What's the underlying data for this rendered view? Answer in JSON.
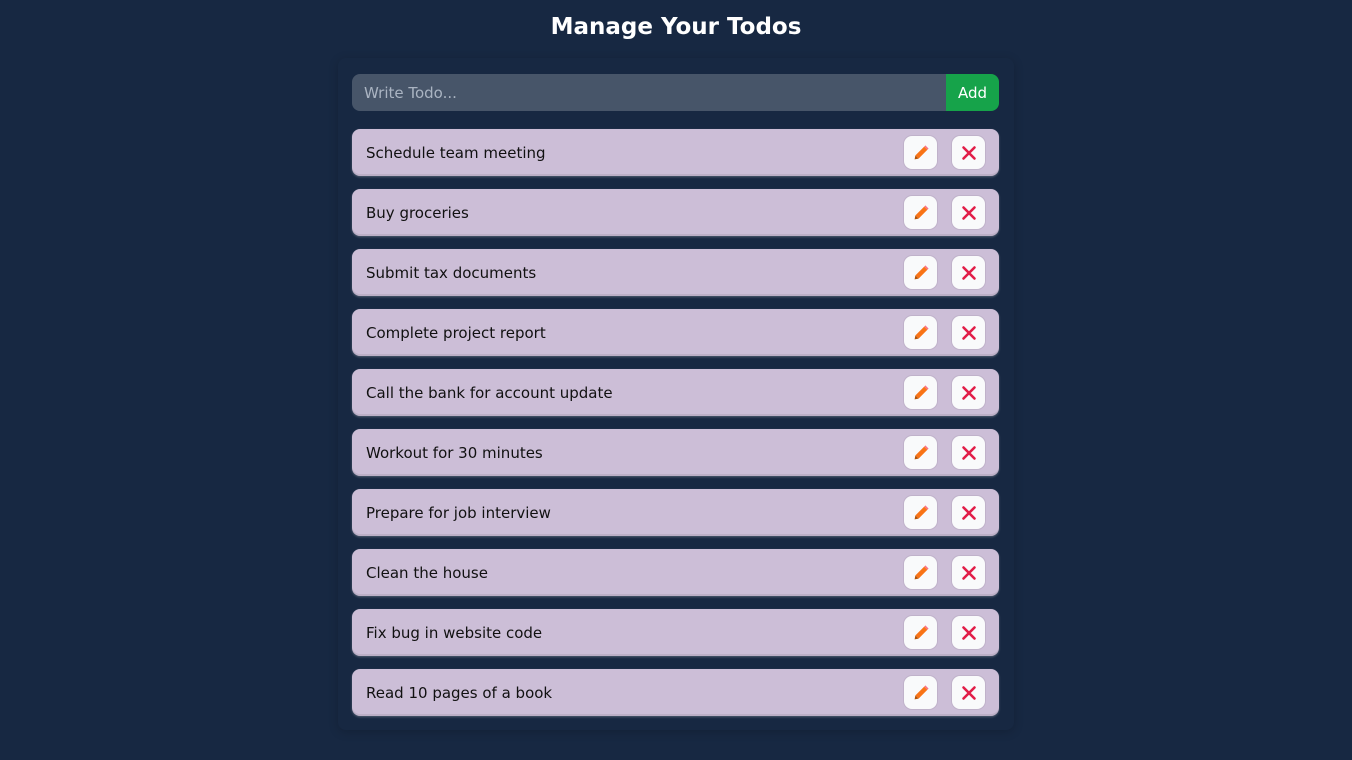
{
  "header": {
    "title": "Manage Your Todos"
  },
  "form": {
    "placeholder": "Write Todo...",
    "value": "",
    "add_label": "Add"
  },
  "todos": [
    {
      "text": "Schedule team meeting"
    },
    {
      "text": "Buy groceries"
    },
    {
      "text": "Submit tax documents"
    },
    {
      "text": "Complete project report"
    },
    {
      "text": "Call the bank for account update"
    },
    {
      "text": "Workout for 30 minutes"
    },
    {
      "text": "Prepare for job interview"
    },
    {
      "text": "Clean the house"
    },
    {
      "text": "Fix bug in website code"
    },
    {
      "text": "Read 10 pages of a book"
    }
  ],
  "icons": {
    "edit": "pencil-icon",
    "delete": "close-icon"
  },
  "colors": {
    "background": "#172842",
    "item_bg": "#ccbed7",
    "input_bg": "#475569",
    "add_button": "#16a34a",
    "pencil": "#f97316",
    "close": "#e11d48"
  }
}
